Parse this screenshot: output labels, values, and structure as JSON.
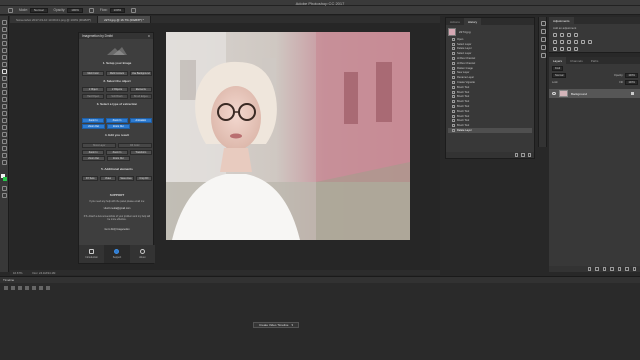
{
  "window": {
    "title": "Adobe Photoshop CC 2017"
  },
  "options_bar": {
    "mode_label": "Mode:",
    "mode_value": "Normal",
    "opacity_label": "Opacity:",
    "opacity_value": "100%",
    "flow_label": "Flow:",
    "flow_value": "100%"
  },
  "doc_tabs": [
    {
      "label": "Screenshot 2017-03-10 13.09.01.png @ 100% (RGB/8*)"
    },
    {
      "label": "2274.jpg @ 16.7% (RGB/8*) *"
    }
  ],
  "plugin": {
    "title": "Imagenetion by Dmitri",
    "step1": "1. Setup your Image",
    "step1_buttons": [
      "Multi Color",
      "Multi Content",
      "Use Background"
    ],
    "step2": "2. Select the object",
    "step2_buttons": [
      "1 Object",
      "2 Objects",
      "Elements"
    ],
    "step2_row2": [
      "Hair/Object",
      "Soft Brush",
      "Brush Edges"
    ],
    "step3": "3. Select a type of extraction",
    "step3_buttons_a": [
      "Zoom In",
      "Zoom In",
      "Animation"
    ],
    "step3_buttons_b": [
      "Zoom Out",
      "Zoom Out"
    ],
    "step4": "4. Edit you result",
    "step4_row1": [
      "Show Layer",
      "Fill Color"
    ],
    "step4_row2": [
      "Zoom In",
      "Zoom In",
      "Transform"
    ],
    "step4_row3": [
      "Zoom Out",
      "Zoom Out"
    ],
    "step5": "5. Additional elements",
    "step5_buttons": [
      "FX Sets",
      "Video",
      "Save Area",
      "Crop Fill"
    ],
    "support_title": "SUPPORT",
    "support_text1": "If you need any help with the panel please email me:",
    "support_email": "vbuzz.media@gmail.com",
    "support_text2": "P.S. Attach a few screenshots of your problem and my help will be more effective.",
    "support_text3": "Go to FAQ Imagenetion",
    "footer": [
      {
        "label": "Introduction"
      },
      {
        "label": "Support"
      },
      {
        "label": "About"
      }
    ]
  },
  "doc_status": {
    "zoom": "16.67%",
    "info": "Doc: 24.1M/24.1M"
  },
  "timeline": {
    "title": "Timeline",
    "create_button": "Create Video Timeline"
  },
  "history_panel": {
    "tabs": [
      "Actions",
      "History"
    ],
    "snapshot": "2274.jpg",
    "items": [
      "Open",
      "Select Layer",
      "Delete Layer",
      "Select Layer",
      "Hi Res Channel",
      "Hi Res Channel",
      "Flatten Image",
      "New Layer",
      "Rename Layer",
      "Create Vignette",
      "Brush Tool",
      "Brush Tool",
      "Brush Tool",
      "Brush Tool",
      "Brush Tool",
      "Brush Tool",
      "Brush Tool",
      "Brush Tool",
      "Brush Tool",
      "Delete Layer"
    ],
    "active_index": 19
  },
  "adjustments_panel": {
    "title": "Adjustments",
    "subtitle": "Add an adjustment"
  },
  "layers_panel": {
    "tabs": [
      "Layers",
      "Channels",
      "Paths"
    ],
    "kind_label": "Kind",
    "blend_mode": "Normal",
    "opacity_label": "Opacity:",
    "opacity_value": "100%",
    "lock_label": "Lock:",
    "fill_label": "Fill:",
    "fill_value": "100%",
    "layer_name": "Background"
  }
}
